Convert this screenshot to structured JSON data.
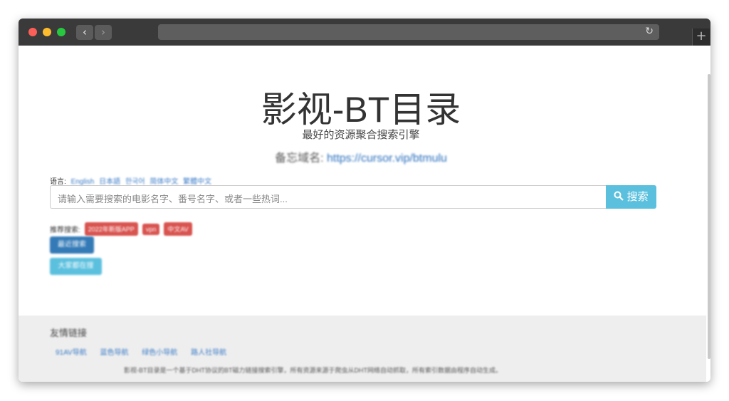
{
  "browser": {
    "back": "‹",
    "forward": "›",
    "reload": "↻",
    "new_tab": "+"
  },
  "header": {
    "title": "影视-BT目录",
    "subtitle": "最好的资源聚合搜索引擎",
    "backup_label": "备忘域名:",
    "backup_url": "https://cursor.vip/btmulu"
  },
  "language": {
    "label": "语言:",
    "options": [
      "English",
      "日本語",
      "한국어",
      "简体中文",
      "繁體中文"
    ]
  },
  "search": {
    "placeholder": "请输入需要搜索的电影名字、番号名字、或者一些热词...",
    "button_label": "搜索",
    "icon": "search-icon"
  },
  "recommend": {
    "label": "推荐搜索:",
    "tags": [
      "2022年新版APP",
      "vpn",
      "中文AV"
    ]
  },
  "buttons": {
    "primary": "最近搜索",
    "info": "大家都在搜"
  },
  "footer": {
    "heading": "友情链接",
    "links": [
      "91AV导航",
      "蓝色导航",
      "绿色小导航",
      "路人社导航"
    ],
    "description": "影视-BT目录是一个基于DHT协议的BT磁力链接搜索引擎，所有资源来源于爬虫从DHT网络自动抓取，所有索引数据由程序自动生成。"
  },
  "colors": {
    "primary": "#337ab7",
    "info": "#5bc0de",
    "danger": "#d9534f",
    "link": "#2a6fbd"
  }
}
